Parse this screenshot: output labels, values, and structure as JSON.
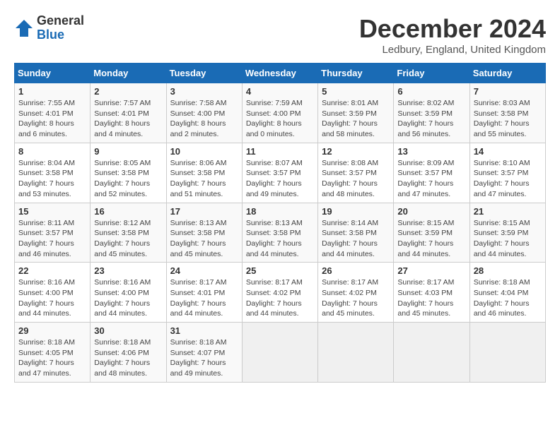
{
  "logo": {
    "general": "General",
    "blue": "Blue"
  },
  "header": {
    "month": "December 2024",
    "location": "Ledbury, England, United Kingdom"
  },
  "weekdays": [
    "Sunday",
    "Monday",
    "Tuesday",
    "Wednesday",
    "Thursday",
    "Friday",
    "Saturday"
  ],
  "weeks": [
    [
      {
        "day": 1,
        "sunrise": "Sunrise: 7:55 AM",
        "sunset": "Sunset: 4:01 PM",
        "daylight": "Daylight: 8 hours and 6 minutes."
      },
      {
        "day": 2,
        "sunrise": "Sunrise: 7:57 AM",
        "sunset": "Sunset: 4:01 PM",
        "daylight": "Daylight: 8 hours and 4 minutes."
      },
      {
        "day": 3,
        "sunrise": "Sunrise: 7:58 AM",
        "sunset": "Sunset: 4:00 PM",
        "daylight": "Daylight: 8 hours and 2 minutes."
      },
      {
        "day": 4,
        "sunrise": "Sunrise: 7:59 AM",
        "sunset": "Sunset: 4:00 PM",
        "daylight": "Daylight: 8 hours and 0 minutes."
      },
      {
        "day": 5,
        "sunrise": "Sunrise: 8:01 AM",
        "sunset": "Sunset: 3:59 PM",
        "daylight": "Daylight: 7 hours and 58 minutes."
      },
      {
        "day": 6,
        "sunrise": "Sunrise: 8:02 AM",
        "sunset": "Sunset: 3:59 PM",
        "daylight": "Daylight: 7 hours and 56 minutes."
      },
      {
        "day": 7,
        "sunrise": "Sunrise: 8:03 AM",
        "sunset": "Sunset: 3:58 PM",
        "daylight": "Daylight: 7 hours and 55 minutes."
      }
    ],
    [
      {
        "day": 8,
        "sunrise": "Sunrise: 8:04 AM",
        "sunset": "Sunset: 3:58 PM",
        "daylight": "Daylight: 7 hours and 53 minutes."
      },
      {
        "day": 9,
        "sunrise": "Sunrise: 8:05 AM",
        "sunset": "Sunset: 3:58 PM",
        "daylight": "Daylight: 7 hours and 52 minutes."
      },
      {
        "day": 10,
        "sunrise": "Sunrise: 8:06 AM",
        "sunset": "Sunset: 3:58 PM",
        "daylight": "Daylight: 7 hours and 51 minutes."
      },
      {
        "day": 11,
        "sunrise": "Sunrise: 8:07 AM",
        "sunset": "Sunset: 3:57 PM",
        "daylight": "Daylight: 7 hours and 49 minutes."
      },
      {
        "day": 12,
        "sunrise": "Sunrise: 8:08 AM",
        "sunset": "Sunset: 3:57 PM",
        "daylight": "Daylight: 7 hours and 48 minutes."
      },
      {
        "day": 13,
        "sunrise": "Sunrise: 8:09 AM",
        "sunset": "Sunset: 3:57 PM",
        "daylight": "Daylight: 7 hours and 47 minutes."
      },
      {
        "day": 14,
        "sunrise": "Sunrise: 8:10 AM",
        "sunset": "Sunset: 3:57 PM",
        "daylight": "Daylight: 7 hours and 47 minutes."
      }
    ],
    [
      {
        "day": 15,
        "sunrise": "Sunrise: 8:11 AM",
        "sunset": "Sunset: 3:57 PM",
        "daylight": "Daylight: 7 hours and 46 minutes."
      },
      {
        "day": 16,
        "sunrise": "Sunrise: 8:12 AM",
        "sunset": "Sunset: 3:58 PM",
        "daylight": "Daylight: 7 hours and 45 minutes."
      },
      {
        "day": 17,
        "sunrise": "Sunrise: 8:13 AM",
        "sunset": "Sunset: 3:58 PM",
        "daylight": "Daylight: 7 hours and 45 minutes."
      },
      {
        "day": 18,
        "sunrise": "Sunrise: 8:13 AM",
        "sunset": "Sunset: 3:58 PM",
        "daylight": "Daylight: 7 hours and 44 minutes."
      },
      {
        "day": 19,
        "sunrise": "Sunrise: 8:14 AM",
        "sunset": "Sunset: 3:58 PM",
        "daylight": "Daylight: 7 hours and 44 minutes."
      },
      {
        "day": 20,
        "sunrise": "Sunrise: 8:15 AM",
        "sunset": "Sunset: 3:59 PM",
        "daylight": "Daylight: 7 hours and 44 minutes."
      },
      {
        "day": 21,
        "sunrise": "Sunrise: 8:15 AM",
        "sunset": "Sunset: 3:59 PM",
        "daylight": "Daylight: 7 hours and 44 minutes."
      }
    ],
    [
      {
        "day": 22,
        "sunrise": "Sunrise: 8:16 AM",
        "sunset": "Sunset: 4:00 PM",
        "daylight": "Daylight: 7 hours and 44 minutes."
      },
      {
        "day": 23,
        "sunrise": "Sunrise: 8:16 AM",
        "sunset": "Sunset: 4:00 PM",
        "daylight": "Daylight: 7 hours and 44 minutes."
      },
      {
        "day": 24,
        "sunrise": "Sunrise: 8:17 AM",
        "sunset": "Sunset: 4:01 PM",
        "daylight": "Daylight: 7 hours and 44 minutes."
      },
      {
        "day": 25,
        "sunrise": "Sunrise: 8:17 AM",
        "sunset": "Sunset: 4:02 PM",
        "daylight": "Daylight: 7 hours and 44 minutes."
      },
      {
        "day": 26,
        "sunrise": "Sunrise: 8:17 AM",
        "sunset": "Sunset: 4:02 PM",
        "daylight": "Daylight: 7 hours and 45 minutes."
      },
      {
        "day": 27,
        "sunrise": "Sunrise: 8:17 AM",
        "sunset": "Sunset: 4:03 PM",
        "daylight": "Daylight: 7 hours and 45 minutes."
      },
      {
        "day": 28,
        "sunrise": "Sunrise: 8:18 AM",
        "sunset": "Sunset: 4:04 PM",
        "daylight": "Daylight: 7 hours and 46 minutes."
      }
    ],
    [
      {
        "day": 29,
        "sunrise": "Sunrise: 8:18 AM",
        "sunset": "Sunset: 4:05 PM",
        "daylight": "Daylight: 7 hours and 47 minutes."
      },
      {
        "day": 30,
        "sunrise": "Sunrise: 8:18 AM",
        "sunset": "Sunset: 4:06 PM",
        "daylight": "Daylight: 7 hours and 48 minutes."
      },
      {
        "day": 31,
        "sunrise": "Sunrise: 8:18 AM",
        "sunset": "Sunset: 4:07 PM",
        "daylight": "Daylight: 7 hours and 49 minutes."
      },
      null,
      null,
      null,
      null
    ]
  ]
}
